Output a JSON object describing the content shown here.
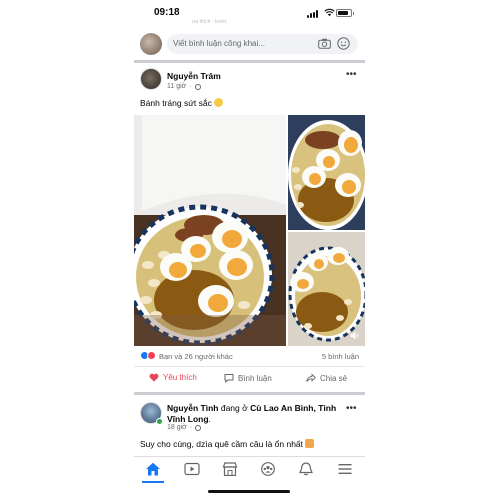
{
  "status_bar": {
    "time": "09:18"
  },
  "previous_strip": "ưa thích · trước",
  "composer": {
    "placeholder": "Viết bình luận công khai..."
  },
  "post": {
    "author": "Nguyễn Trâm",
    "time": "11 giờ",
    "text": "Bánh tráng sứt sắc",
    "reactions_text": "Bạn và 26 người khác",
    "comments_count": "5 bình luận",
    "actions": {
      "like": "Yêu thích",
      "comment": "Bình luận",
      "share": "Chia sẻ"
    }
  },
  "post2": {
    "author": "Nguyễn Tình",
    "verb": " đang ở ",
    "location": "Cù Lao An Bình, Tỉnh Vĩnh Long",
    "period": ".",
    "time": "18 giờ",
    "text": "Suy cho cùng, dzìa quê cầm câu là ổn nhất"
  },
  "colors": {
    "accent": "#1877f2",
    "love": "#e8475b",
    "muted": "#65676b",
    "background": "#ffffff"
  },
  "icons": {
    "nav": [
      "home-icon",
      "video-icon",
      "marketplace-icon",
      "groups-icon",
      "notifications-icon",
      "menu-icon"
    ]
  }
}
